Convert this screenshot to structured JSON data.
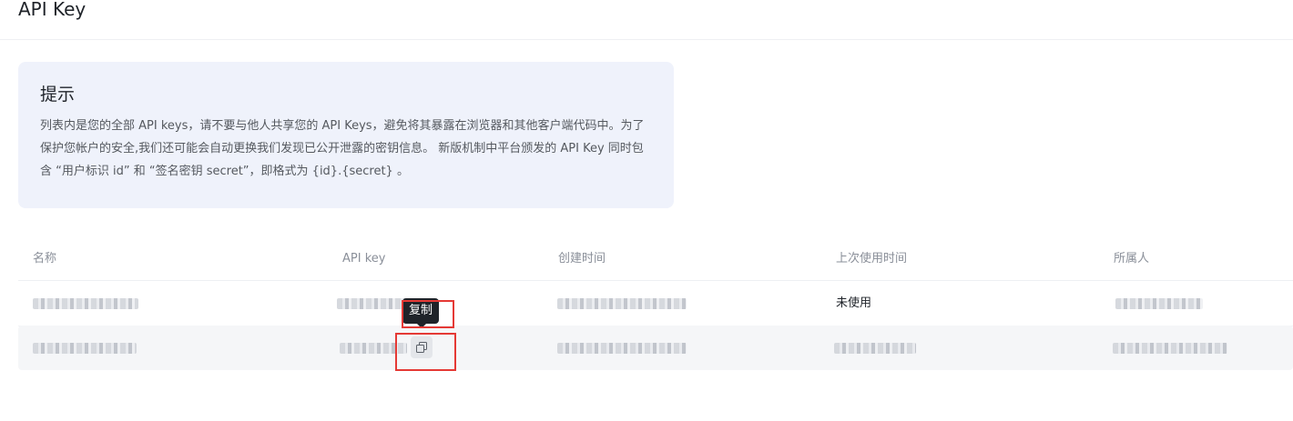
{
  "page": {
    "title": "API Key"
  },
  "tip": {
    "title": "提示",
    "text": "列表内是您的全部 API keys，请不要与他人共享您的 API Keys，避免将其暴露在浏览器和其他客户端代码中。为了保护您帐户的安全,我们还可能会自动更换我们发现已公开泄露的密钥信息。 新版机制中平台颁发的 API Key 同时包含 “用户标识 id” 和 “签名密钥 secret”，即格式为 {id}.{secret} 。"
  },
  "table": {
    "columns": [
      "名称",
      "API key",
      "创建时间",
      "上次使用时间",
      "所属人"
    ],
    "rows": [
      {
        "last_used": "未使用"
      },
      {
        "last_used": ""
      }
    ]
  },
  "tooltip": {
    "copy": "复制"
  },
  "icons": {
    "copy": "copy-icon"
  },
  "colors": {
    "highlight": "#e53935",
    "tip_bg": "#eff2fb",
    "tooltip_bg": "#1f2329"
  }
}
